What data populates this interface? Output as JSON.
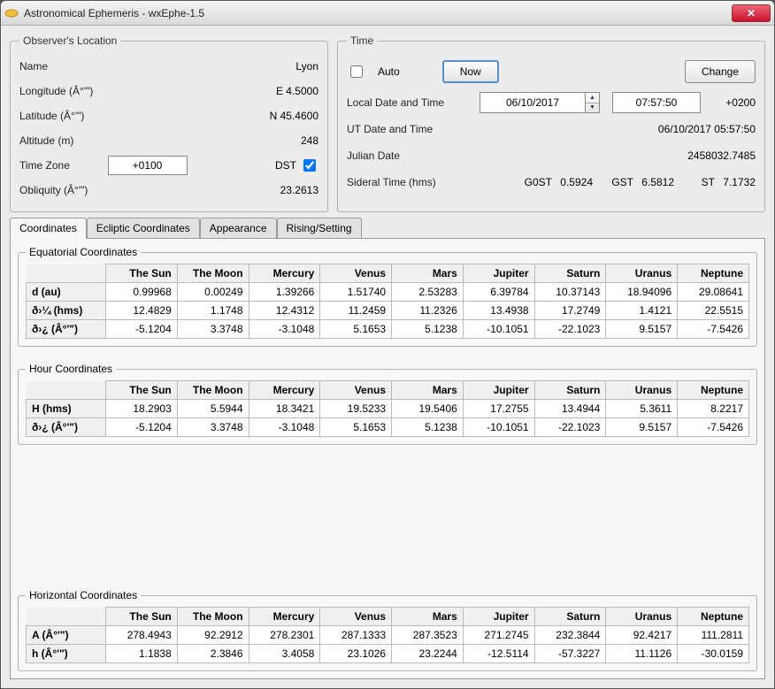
{
  "window": {
    "title": "Astronomical Ephemeris - wxEphe-1.5"
  },
  "observer": {
    "legend": "Observer's Location",
    "name_label": "Name",
    "name_value": "Lyon",
    "longitude_label": "Longitude (Â°'\")",
    "longitude_value": "E  4.5000",
    "latitude_label": "Latitude (Â°'\")",
    "latitude_value": "N  45.4600",
    "altitude_label": "Altitude (m)",
    "altitude_value": "248",
    "timezone_label": "Time Zone",
    "timezone_value": "+0100",
    "dst_label": "DST",
    "dst_checked": true,
    "obliquity_label": "Obliquity (Â°'\")",
    "obliquity_value": "23.2613"
  },
  "time": {
    "legend": "Time",
    "auto_label": "Auto",
    "auto_checked": false,
    "now_button": "Now",
    "change_button": "Change",
    "local_label": "Local Date and Time",
    "local_date": "06/10/2017",
    "local_time": "07:57:50",
    "local_offset": "+0200",
    "ut_label": "UT Date and Time",
    "ut_value": "06/10/2017 05:57:50",
    "julian_label": "Julian Date",
    "julian_value": "2458032.7485",
    "sidereal_label": "Sideral Time (hms)",
    "sidereal": {
      "g0st_label": "G0ST",
      "g0st": "0.5924",
      "gst_label": "GST",
      "gst": "6.5812",
      "st_label": "ST",
      "st": "7.1732"
    }
  },
  "tabs": {
    "t1": "Coordinates",
    "t2": "Ecliptic Coordinates",
    "t3": "Appearance",
    "t4": "Rising/Setting"
  },
  "bodies": [
    "The Sun",
    "The Moon",
    "Mercury",
    "Venus",
    "Mars",
    "Jupiter",
    "Saturn",
    "Uranus",
    "Neptune"
  ],
  "equatorial": {
    "legend": "Equatorial Coordinates",
    "rows": [
      {
        "label": "d (au)",
        "v": [
          "0.99968",
          "0.00249",
          "1.39266",
          "1.51740",
          "2.53283",
          "6.39784",
          "10.37143",
          "18.94096",
          "29.08641"
        ]
      },
      {
        "label": "ð›¼ (hms)",
        "v": [
          "12.4829",
          "1.1748",
          "12.4312",
          "11.2459",
          "11.2326",
          "13.4938",
          "17.2749",
          "1.4121",
          "22.5515"
        ]
      },
      {
        "label": "ð›¿ (Â°'\")",
        "v": [
          "-5.1204",
          "3.3748",
          "-3.1048",
          "5.1653",
          "5.1238",
          "-10.1051",
          "-22.1023",
          "9.5157",
          "-7.5426"
        ]
      }
    ]
  },
  "hour": {
    "legend": "Hour Coordinates",
    "rows": [
      {
        "label": "H (hms)",
        "v": [
          "18.2903",
          "5.5944",
          "18.3421",
          "19.5233",
          "19.5406",
          "17.2755",
          "13.4944",
          "5.3611",
          "8.2217"
        ]
      },
      {
        "label": "ð›¿ (Â°'\")",
        "v": [
          "-5.1204",
          "3.3748",
          "-3.1048",
          "5.1653",
          "5.1238",
          "-10.1051",
          "-22.1023",
          "9.5157",
          "-7.5426"
        ]
      }
    ]
  },
  "horizontal": {
    "legend": "Horizontal Coordinates",
    "rows": [
      {
        "label": "A (Â°'\")",
        "v": [
          "278.4943",
          "92.2912",
          "278.2301",
          "287.1333",
          "287.3523",
          "271.2745",
          "232.3844",
          "92.4217",
          "111.2811"
        ]
      },
      {
        "label": "h (Â°'\")",
        "v": [
          "1.1838",
          "2.3846",
          "3.4058",
          "23.1026",
          "23.2244",
          "-12.5114",
          "-57.3227",
          "11.1126",
          "-30.0159"
        ]
      }
    ]
  }
}
